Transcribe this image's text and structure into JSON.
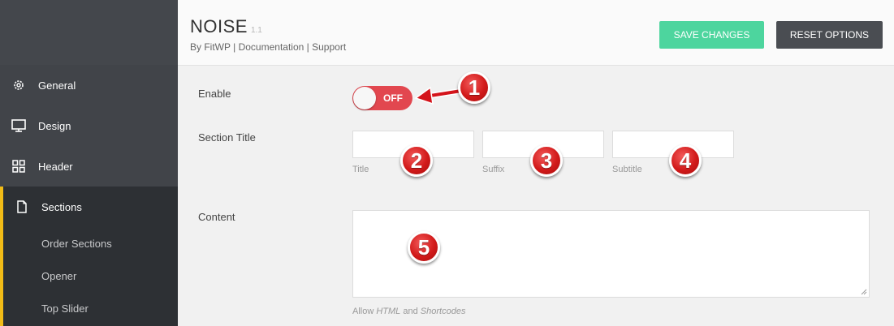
{
  "sidebar": {
    "items": [
      {
        "label": "General",
        "icon": "gear-icon"
      },
      {
        "label": "Design",
        "icon": "monitor-icon"
      },
      {
        "label": "Header",
        "icon": "grid-icon"
      },
      {
        "label": "Sections",
        "icon": "page-icon"
      }
    ],
    "subitems": [
      "Order Sections",
      "Opener",
      "Top Slider"
    ],
    "active_color": "#f2bc17"
  },
  "header": {
    "title": "NOISE",
    "version": "1.1",
    "by": "By FitWP",
    "sep": "|",
    "documentation": "Documentation",
    "support": "Support",
    "save_label": "SAVE CHANGES",
    "reset_label": "RESET OPTIONS",
    "save_color": "#4dd59e",
    "reset_color": "#4a4d52"
  },
  "fields": {
    "enable_label": "Enable",
    "toggle_text": "OFF",
    "toggle_color": "#e2474f",
    "section_title_label": "Section Title",
    "title_hint": "Title",
    "suffix_hint": "Suffix",
    "subtitle_hint": "Subtitle",
    "content_label": "Content",
    "allow_prefix": "Allow",
    "allow_html": "HTML",
    "allow_and": "and",
    "allow_shortcodes": "Shortcodes"
  },
  "callouts": [
    "1",
    "2",
    "3",
    "4",
    "5"
  ]
}
